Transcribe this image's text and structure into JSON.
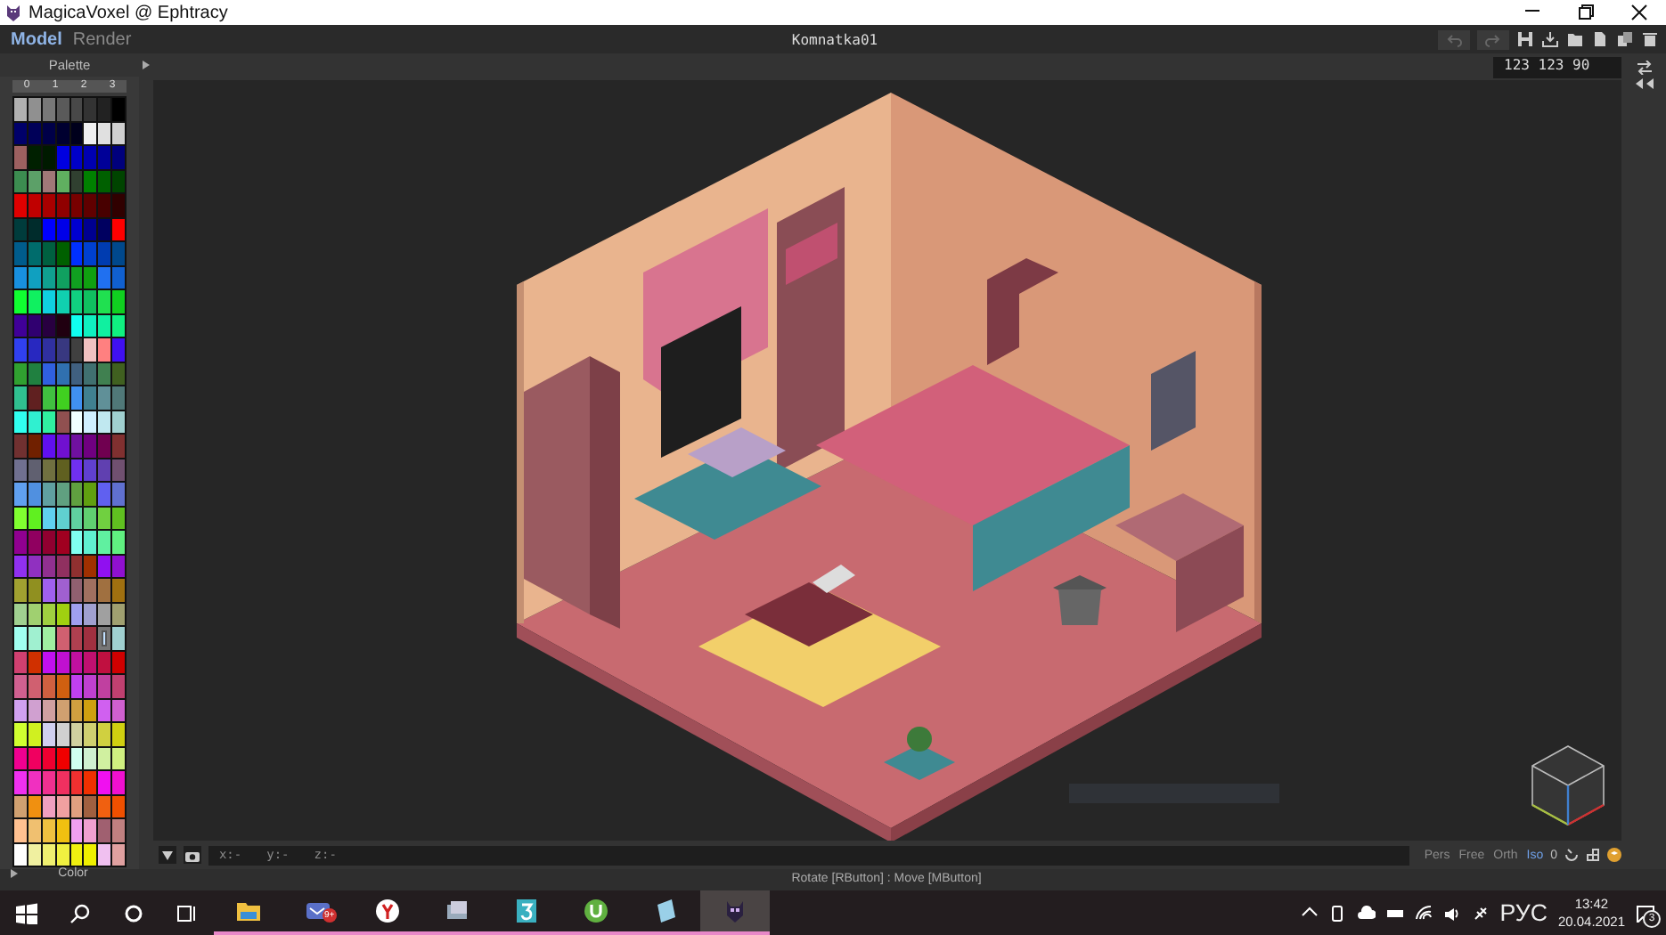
{
  "window": {
    "title": "MagicaVoxel @ Ephtracy"
  },
  "menu": {
    "tabs": [
      {
        "label": "Model",
        "selected": true
      },
      {
        "label": "Render",
        "selected": false
      }
    ],
    "document_title": "Komnatka01"
  },
  "toolbar": {
    "size_field": "123 123 90"
  },
  "palette": {
    "title": "Palette",
    "column_labels": [
      "0",
      "1",
      "2",
      "3"
    ],
    "footer": "Color",
    "rows": [
      {
        "swatches": [
          {
            "color": "#b0b0b0",
            "selected": false
          },
          {
            "color": "#909090",
            "selected": false
          },
          {
            "color": "#787878",
            "selected": false
          },
          {
            "color": "#5a5a5a",
            "selected": false
          },
          {
            "color": "#484848",
            "selected": false
          },
          {
            "color": "#333333",
            "selected": false
          },
          {
            "color": "#222222",
            "selected": false
          },
          {
            "color": "#000000",
            "selected": false
          }
        ]
      },
      {
        "swatches": [
          {
            "color": "#00006a",
            "selected": false
          },
          {
            "color": "#000058",
            "selected": false
          },
          {
            "color": "#000048",
            "selected": false
          },
          {
            "color": "#000030",
            "selected": false
          },
          {
            "color": "#00001c",
            "selected": false
          },
          {
            "color": "#f0f0f0",
            "selected": false
          },
          {
            "color": "#e0e0e0",
            "selected": false
          },
          {
            "color": "#d0d0d0",
            "selected": false
          }
        ]
      },
      {
        "swatches": [
          {
            "color": "#9c6060",
            "selected": false
          },
          {
            "color": "#002000",
            "selected": false
          },
          {
            "color": "#001a00",
            "selected": false
          },
          {
            "color": "#0000e0",
            "selected": false
          },
          {
            "color": "#0000c8",
            "selected": false
          },
          {
            "color": "#0000b0",
            "selected": false
          },
          {
            "color": "#000098",
            "selected": false
          },
          {
            "color": "#00007c",
            "selected": false
          }
        ]
      },
      {
        "swatches": [
          {
            "color": "#3c8c50",
            "selected": false
          },
          {
            "color": "#5ca068",
            "selected": false
          },
          {
            "color": "#a07878",
            "selected": false
          },
          {
            "color": "#60b060",
            "selected": false
          },
          {
            "color": "#304030",
            "selected": false
          },
          {
            "color": "#008000",
            "selected": false
          },
          {
            "color": "#006000",
            "selected": false
          },
          {
            "color": "#004400",
            "selected": false
          }
        ]
      },
      {
        "swatches": [
          {
            "color": "#e00000",
            "selected": false
          },
          {
            "color": "#c00000",
            "selected": false
          },
          {
            "color": "#a80000",
            "selected": false
          },
          {
            "color": "#900000",
            "selected": false
          },
          {
            "color": "#780000",
            "selected": false
          },
          {
            "color": "#600000",
            "selected": false
          },
          {
            "color": "#480000",
            "selected": false
          },
          {
            "color": "#300000",
            "selected": false
          }
        ]
      },
      {
        "swatches": [
          {
            "color": "#003c3c",
            "selected": false
          },
          {
            "color": "#002c2c",
            "selected": false
          },
          {
            "color": "#0000ff",
            "selected": false
          },
          {
            "color": "#0000e8",
            "selected": false
          },
          {
            "color": "#0000d0",
            "selected": false
          },
          {
            "color": "#000090",
            "selected": false
          },
          {
            "color": "#000060",
            "selected": false
          },
          {
            "color": "#ff0000",
            "selected": false
          }
        ]
      },
      {
        "swatches": [
          {
            "color": "#005c8c",
            "selected": false
          },
          {
            "color": "#006c6c",
            "selected": false
          },
          {
            "color": "#006040",
            "selected": false
          },
          {
            "color": "#006000",
            "selected": false
          },
          {
            "color": "#0030ff",
            "selected": false
          },
          {
            "color": "#0040d0",
            "selected": false
          },
          {
            "color": "#003cb0",
            "selected": false
          },
          {
            "color": "#00488c",
            "selected": false
          }
        ]
      },
      {
        "swatches": [
          {
            "color": "#1890e0",
            "selected": false
          },
          {
            "color": "#10a0c0",
            "selected": false
          },
          {
            "color": "#10a090",
            "selected": false
          },
          {
            "color": "#10a060",
            "selected": false
          },
          {
            "color": "#10a020",
            "selected": false
          },
          {
            "color": "#10a010",
            "selected": false
          },
          {
            "color": "#2070f0",
            "selected": false
          },
          {
            "color": "#1060d0",
            "selected": false
          }
        ]
      },
      {
        "swatches": [
          {
            "color": "#10ff30",
            "selected": false
          },
          {
            "color": "#10f060",
            "selected": false
          },
          {
            "color": "#10d0e0",
            "selected": false
          },
          {
            "color": "#10d0b0",
            "selected": false
          },
          {
            "color": "#10d080",
            "selected": false
          },
          {
            "color": "#10c060",
            "selected": false
          },
          {
            "color": "#20e050",
            "selected": false
          },
          {
            "color": "#10d020",
            "selected": false
          }
        ]
      },
      {
        "swatches": [
          {
            "color": "#400098",
            "selected": false
          },
          {
            "color": "#300070",
            "selected": false
          },
          {
            "color": "#280040",
            "selected": false
          },
          {
            "color": "#200010",
            "selected": false
          },
          {
            "color": "#10fff0",
            "selected": false
          },
          {
            "color": "#10f0c0",
            "selected": false
          },
          {
            "color": "#10f0a0",
            "selected": false
          },
          {
            "color": "#10f080",
            "selected": false
          }
        ]
      },
      {
        "swatches": [
          {
            "color": "#3040f0",
            "selected": false
          },
          {
            "color": "#2828c0",
            "selected": false
          },
          {
            "color": "#3030a0",
            "selected": false
          },
          {
            "color": "#383880",
            "selected": false
          },
          {
            "color": "#404040",
            "selected": false
          },
          {
            "color": "#f0c0c0",
            "selected": false
          },
          {
            "color": "#ff8080",
            "selected": false
          },
          {
            "color": "#4010f0",
            "selected": false
          }
        ]
      },
      {
        "swatches": [
          {
            "color": "#30a030",
            "selected": false
          },
          {
            "color": "#208040",
            "selected": false
          },
          {
            "color": "#3060e0",
            "selected": false
          },
          {
            "color": "#3070b0",
            "selected": false
          },
          {
            "color": "#406080",
            "selected": false
          },
          {
            "color": "#407070",
            "selected": false
          },
          {
            "color": "#408050",
            "selected": false
          },
          {
            "color": "#406020",
            "selected": false
          }
        ]
      },
      {
        "swatches": [
          {
            "color": "#30c090",
            "selected": false
          },
          {
            "color": "#602020",
            "selected": false
          },
          {
            "color": "#40c040",
            "selected": false
          },
          {
            "color": "#40d020",
            "selected": false
          },
          {
            "color": "#4090f0",
            "selected": false
          },
          {
            "color": "#408090",
            "selected": false
          },
          {
            "color": "#609098",
            "selected": false
          },
          {
            "color": "#507878",
            "selected": false
          }
        ]
      },
      {
        "swatches": [
          {
            "color": "#30fff0",
            "selected": false
          },
          {
            "color": "#30f0d0",
            "selected": false
          },
          {
            "color": "#30f0a0",
            "selected": false
          },
          {
            "color": "#905050",
            "selected": false
          },
          {
            "color": "#f0ffff",
            "selected": false
          },
          {
            "color": "#d0f0ff",
            "selected": false
          },
          {
            "color": "#c0e8f0",
            "selected": false
          },
          {
            "color": "#a0d0d0",
            "selected": false
          }
        ]
      },
      {
        "swatches": [
          {
            "color": "#703030",
            "selected": false
          },
          {
            "color": "#702000",
            "selected": false
          },
          {
            "color": "#6010f0",
            "selected": false
          },
          {
            "color": "#7010d0",
            "selected": false
          },
          {
            "color": "#7010a0",
            "selected": false
          },
          {
            "color": "#700080",
            "selected": false
          },
          {
            "color": "#700050",
            "selected": false
          },
          {
            "color": "#803030",
            "selected": false
          }
        ]
      },
      {
        "swatches": [
          {
            "color": "#707090",
            "selected": false
          },
          {
            "color": "#606070",
            "selected": false
          },
          {
            "color": "#707040",
            "selected": false
          },
          {
            "color": "#606020",
            "selected": false
          },
          {
            "color": "#7030f0",
            "selected": false
          },
          {
            "color": "#6040d0",
            "selected": false
          },
          {
            "color": "#6040b0",
            "selected": false
          },
          {
            "color": "#705070",
            "selected": false
          }
        ]
      },
      {
        "swatches": [
          {
            "color": "#60a0f0",
            "selected": false
          },
          {
            "color": "#5090e0",
            "selected": false
          },
          {
            "color": "#60a0a0",
            "selected": false
          },
          {
            "color": "#60a080",
            "selected": false
          },
          {
            "color": "#60a040",
            "selected": false
          },
          {
            "color": "#60a010",
            "selected": false
          },
          {
            "color": "#6060f0",
            "selected": false
          },
          {
            "color": "#6070d0",
            "selected": false
          }
        ]
      },
      {
        "swatches": [
          {
            "color": "#80ff30",
            "selected": false
          },
          {
            "color": "#60f020",
            "selected": false
          },
          {
            "color": "#60d0f0",
            "selected": false
          },
          {
            "color": "#60d0d0",
            "selected": false
          },
          {
            "color": "#60d0a0",
            "selected": false
          },
          {
            "color": "#60d070",
            "selected": false
          },
          {
            "color": "#70d040",
            "selected": false
          },
          {
            "color": "#60c020",
            "selected": false
          }
        ]
      },
      {
        "swatches": [
          {
            "color": "#900090",
            "selected": false
          },
          {
            "color": "#900060",
            "selected": false
          },
          {
            "color": "#900030",
            "selected": false
          },
          {
            "color": "#a00020",
            "selected": false
          },
          {
            "color": "#80fff0",
            "selected": false
          },
          {
            "color": "#60f0d0",
            "selected": false
          },
          {
            "color": "#60f0a0",
            "selected": false
          },
          {
            "color": "#60f080",
            "selected": false
          }
        ]
      },
      {
        "swatches": [
          {
            "color": "#9030f0",
            "selected": false
          },
          {
            "color": "#9030c0",
            "selected": false
          },
          {
            "color": "#903090",
            "selected": false
          },
          {
            "color": "#903060",
            "selected": false
          },
          {
            "color": "#903030",
            "selected": false
          },
          {
            "color": "#a03000",
            "selected": false
          },
          {
            "color": "#9010f0",
            "selected": false
          },
          {
            "color": "#9010d0",
            "selected": false
          }
        ]
      },
      {
        "swatches": [
          {
            "color": "#a0a030",
            "selected": false
          },
          {
            "color": "#909020",
            "selected": false
          },
          {
            "color": "#a060f0",
            "selected": false
          },
          {
            "color": "#a060d0",
            "selected": false
          },
          {
            "color": "#906070",
            "selected": false
          },
          {
            "color": "#a07060",
            "selected": false
          },
          {
            "color": "#a07040",
            "selected": false
          },
          {
            "color": "#a07010",
            "selected": false
          }
        ]
      },
      {
        "swatches": [
          {
            "color": "#a0d090",
            "selected": false
          },
          {
            "color": "#a0d070",
            "selected": false
          },
          {
            "color": "#a0d040",
            "selected": false
          },
          {
            "color": "#a0d010",
            "selected": false
          },
          {
            "color": "#a0a0f0",
            "selected": false
          },
          {
            "color": "#a0a0d0",
            "selected": false
          },
          {
            "color": "#a0a0a0",
            "selected": false
          },
          {
            "color": "#a0a070",
            "selected": false
          }
        ]
      },
      {
        "swatches": [
          {
            "color": "#a0fff0",
            "selected": false
          },
          {
            "color": "#a0f0d0",
            "selected": false
          },
          {
            "color": "#a0f0a0",
            "selected": false
          },
          {
            "color": "#d06070",
            "selected": false
          },
          {
            "color": "#b04050",
            "selected": false
          },
          {
            "color": "#a03040",
            "selected": false
          },
          {
            "color": "#c0e0ff",
            "selected": true
          },
          {
            "color": "#a0d0d0",
            "selected": false
          }
        ]
      },
      {
        "swatches": [
          {
            "color": "#d04070",
            "selected": false
          },
          {
            "color": "#d03000",
            "selected": false
          },
          {
            "color": "#c010f0",
            "selected": false
          },
          {
            "color": "#c010d0",
            "selected": false
          },
          {
            "color": "#c010a0",
            "selected": false
          },
          {
            "color": "#c01070",
            "selected": false
          },
          {
            "color": "#c01040",
            "selected": false
          },
          {
            "color": "#d00000",
            "selected": false
          }
        ]
      },
      {
        "swatches": [
          {
            "color": "#d06090",
            "selected": false
          },
          {
            "color": "#d06070",
            "selected": false
          },
          {
            "color": "#d06040",
            "selected": false
          },
          {
            "color": "#d06010",
            "selected": false
          },
          {
            "color": "#c040f0",
            "selected": false
          },
          {
            "color": "#c040d0",
            "selected": false
          },
          {
            "color": "#c040a0",
            "selected": false
          },
          {
            "color": "#c04070",
            "selected": false
          }
        ]
      },
      {
        "swatches": [
          {
            "color": "#d0a0f0",
            "selected": false
          },
          {
            "color": "#d0a0d0",
            "selected": false
          },
          {
            "color": "#d0a0a0",
            "selected": false
          },
          {
            "color": "#d0a070",
            "selected": false
          },
          {
            "color": "#d0a040",
            "selected": false
          },
          {
            "color": "#d0a010",
            "selected": false
          },
          {
            "color": "#d060f0",
            "selected": false
          },
          {
            "color": "#d060d0",
            "selected": false
          }
        ]
      },
      {
        "swatches": [
          {
            "color": "#d0ff30",
            "selected": false
          },
          {
            "color": "#d0f020",
            "selected": false
          },
          {
            "color": "#d0d0f0",
            "selected": false
          },
          {
            "color": "#d0d0d0",
            "selected": false
          },
          {
            "color": "#d0d0a0",
            "selected": false
          },
          {
            "color": "#d0d070",
            "selected": false
          },
          {
            "color": "#d0d040",
            "selected": false
          },
          {
            "color": "#d0d010",
            "selected": false
          }
        ]
      },
      {
        "swatches": [
          {
            "color": "#f00090",
            "selected": false
          },
          {
            "color": "#f00060",
            "selected": false
          },
          {
            "color": "#f00030",
            "selected": false
          },
          {
            "color": "#f00000",
            "selected": false
          },
          {
            "color": "#d0fff0",
            "selected": false
          },
          {
            "color": "#d0f0d0",
            "selected": false
          },
          {
            "color": "#d0f0a0",
            "selected": false
          },
          {
            "color": "#d0f080",
            "selected": false
          }
        ]
      },
      {
        "swatches": [
          {
            "color": "#f030f0",
            "selected": false
          },
          {
            "color": "#f030c0",
            "selected": false
          },
          {
            "color": "#f03090",
            "selected": false
          },
          {
            "color": "#f03060",
            "selected": false
          },
          {
            "color": "#f03030",
            "selected": false
          },
          {
            "color": "#f03000",
            "selected": false
          },
          {
            "color": "#f010f0",
            "selected": false
          },
          {
            "color": "#f010d0",
            "selected": false
          }
        ]
      },
      {
        "swatches": [
          {
            "color": "#d0a070",
            "selected": false
          },
          {
            "color": "#f09010",
            "selected": false
          },
          {
            "color": "#f0a0c0",
            "selected": false
          },
          {
            "color": "#f0a0a0",
            "selected": false
          },
          {
            "color": "#e0a080",
            "selected": false
          },
          {
            "color": "#a06040",
            "selected": false
          },
          {
            "color": "#f06010",
            "selected": false
          },
          {
            "color": "#f05000",
            "selected": false
          }
        ]
      },
      {
        "swatches": [
          {
            "color": "#ffc090",
            "selected": false
          },
          {
            "color": "#f0c070",
            "selected": false
          },
          {
            "color": "#f0c040",
            "selected": false
          },
          {
            "color": "#f0c010",
            "selected": false
          },
          {
            "color": "#f0a0f0",
            "selected": false
          },
          {
            "color": "#f0a0d0",
            "selected": false
          },
          {
            "color": "#a06070",
            "selected": false
          },
          {
            "color": "#c08080",
            "selected": false
          }
        ]
      },
      {
        "swatches": [
          {
            "color": "#ffffff",
            "selected": false
          },
          {
            "color": "#f0f0a0",
            "selected": false
          },
          {
            "color": "#f0f070",
            "selected": false
          },
          {
            "color": "#f0f040",
            "selected": false
          },
          {
            "color": "#f0f010",
            "selected": false
          },
          {
            "color": "#f0f000",
            "selected": false
          },
          {
            "color": "#f0c0f0",
            "selected": false
          },
          {
            "color": "#e0a0a0",
            "selected": false
          }
        ]
      }
    ]
  },
  "bottom_bar": {
    "coordinates": [
      "x:-",
      "y:-",
      "z:-"
    ],
    "view_modes": [
      {
        "label": "Pers",
        "selected": false
      },
      {
        "label": "Free",
        "selected": false
      },
      {
        "label": "Orth",
        "selected": false
      },
      {
        "label": "Iso",
        "selected": true
      }
    ],
    "zoom_label": "0"
  },
  "status_text": "Rotate [RButton] : Move [MButton]",
  "taskbar": {
    "apps": [
      {
        "kind": "folder",
        "active": false
      },
      {
        "kind": "mail",
        "active": false,
        "badge": "9+"
      },
      {
        "kind": "browser",
        "active": false
      },
      {
        "kind": "photos",
        "active": false
      },
      {
        "kind": "three",
        "active": false
      },
      {
        "kind": "torrent",
        "active": false
      },
      {
        "kind": "notepad",
        "active": false
      },
      {
        "kind": "voxel",
        "active": true
      }
    ],
    "language": "РУС",
    "time": "13:42",
    "date": "20.04.2021",
    "notification_count": "3"
  }
}
